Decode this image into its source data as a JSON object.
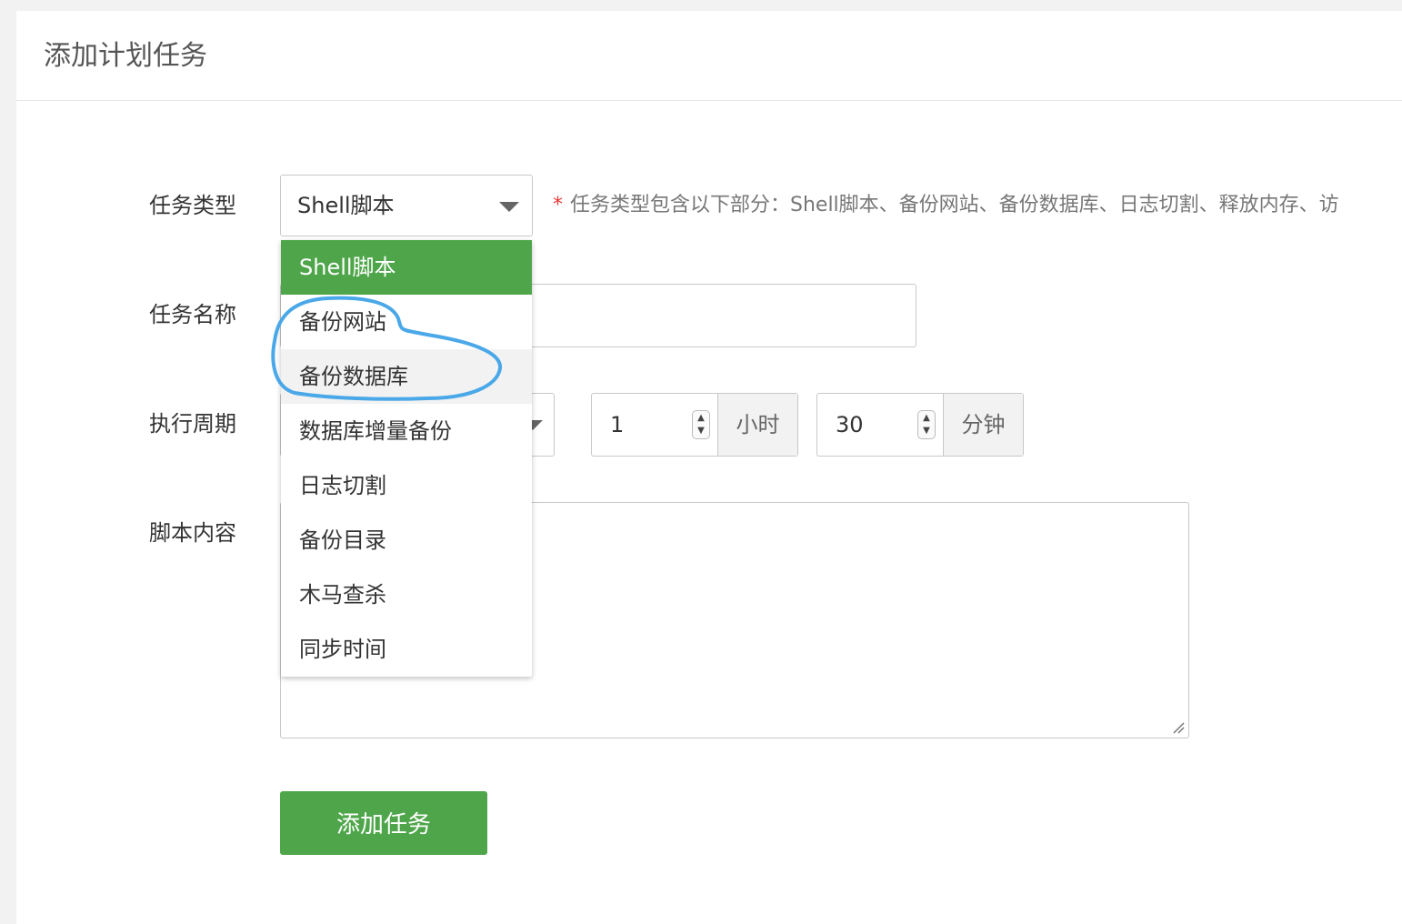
{
  "header": {
    "title": "添加计划任务"
  },
  "form": {
    "task_type": {
      "label": "任务类型",
      "value": "Shell脚本",
      "hint_star": "*",
      "hint": "任务类型包含以下部分：Shell脚本、备份网站、备份数据库、日志切割、释放内存、访"
    },
    "task_name": {
      "label": "任务名称",
      "value": ""
    },
    "cycle": {
      "label": "执行周期",
      "hours_value": "1",
      "hours_unit": "小时",
      "minutes_value": "30",
      "minutes_unit": "分钟"
    },
    "script": {
      "label": "脚本内容",
      "value": ""
    },
    "submit_label": "添加任务"
  },
  "dropdown": {
    "options": [
      {
        "label": "Shell脚本",
        "state": "selected"
      },
      {
        "label": "备份网站",
        "state": "normal"
      },
      {
        "label": "备份数据库",
        "state": "hover"
      },
      {
        "label": "数据库增量备份",
        "state": "normal"
      },
      {
        "label": "日志切割",
        "state": "normal"
      },
      {
        "label": "备份目录",
        "state": "normal"
      },
      {
        "label": "木马查杀",
        "state": "normal"
      },
      {
        "label": "同步时间",
        "state": "normal"
      }
    ]
  },
  "colors": {
    "accent": "#4fa64a",
    "annotation": "#4aa8e8",
    "required": "#e53935"
  },
  "icons": {
    "select_caret": "caret-down-icon",
    "spinner": "spinner-arrows-icon",
    "resize": "resize-grip-icon"
  }
}
